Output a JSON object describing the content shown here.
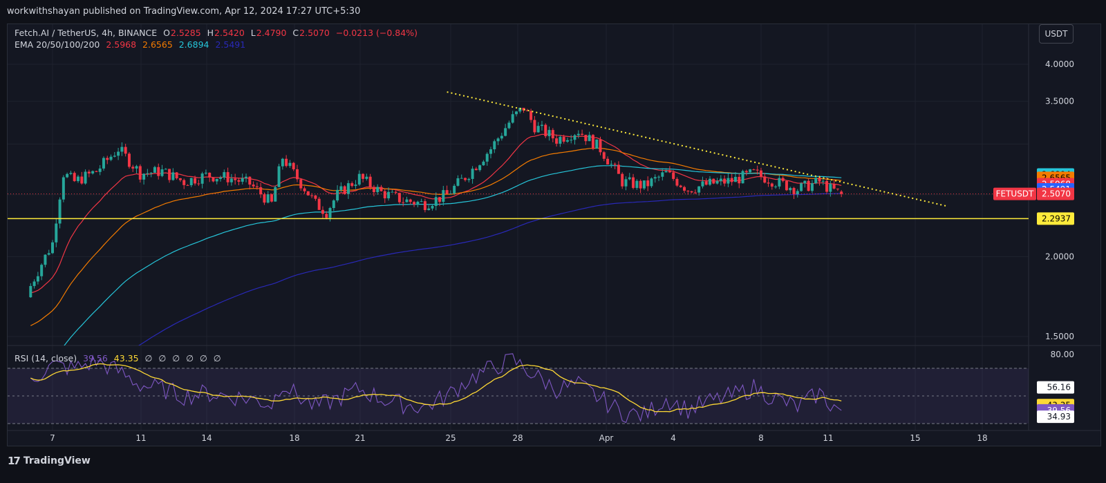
{
  "header": {
    "publisher": "workwithshayan published on TradingView.com, Apr 12, 2024 17:27 UTC+5:30"
  },
  "legend": {
    "symbol": "Fetch.AI / TetherUS, 4h, BINANCE",
    "o_label": "O",
    "o_value": "2.5285",
    "h_label": "H",
    "h_value": "2.5420",
    "l_label": "L",
    "l_value": "2.4790",
    "c_label": "C",
    "c_value": "2.5070",
    "change": "−0.0213 (−0.84%)",
    "ema_label": "EMA 20/50/100/200",
    "ema20": "2.5968",
    "ema50": "2.6565",
    "ema100": "2.6894",
    "ema200": "2.5491"
  },
  "rsi_legend": {
    "label": "RSI (14, close)",
    "rsi": "39.56",
    "ma": "43.35",
    "empties": [
      "∅",
      "∅",
      "∅",
      "∅",
      "∅",
      "∅"
    ]
  },
  "currency_button": "USDT",
  "footer": {
    "brand": "TradingView",
    "brand_mark": "17"
  },
  "colors": {
    "up": "#26a69a",
    "down": "#f23645",
    "ema20": "#f23645",
    "ema50": "#f57c00",
    "ema100": "#26c6da",
    "ema200": "#2929b8",
    "support": "#ffeb3b",
    "trendline": "#ffeb3b",
    "rsi": "#7e57c2",
    "rsi_ma": "#fdd835"
  },
  "chart_data": [
    {
      "type": "candlestick",
      "title": "Fetch.AI / TetherUS, 4h, BINANCE",
      "x_ticks": [
        "7",
        "11",
        "14",
        "18",
        "21",
        "25",
        "28",
        "Apr",
        "4",
        "8",
        "11",
        "15",
        "18"
      ],
      "y_ticks": [
        "4.0000",
        "3.5000",
        "2.0000",
        "1.5000"
      ],
      "ylim": [
        1.45,
        4.3
      ],
      "price_scale": "log",
      "anchors": [
        {
          "t": "Mar 6",
          "p": 1.8
        },
        {
          "t": "Mar 7",
          "p": 2.1
        },
        {
          "t": "Mar 7.5",
          "p": 2.7
        },
        {
          "t": "Mar 8",
          "p": 2.62
        },
        {
          "t": "Mar 9",
          "p": 2.72
        },
        {
          "t": "Mar 10",
          "p": 2.95
        },
        {
          "t": "Mar 11",
          "p": 2.7
        },
        {
          "t": "Mar 12",
          "p": 2.72
        },
        {
          "t": "Mar 13",
          "p": 2.62
        },
        {
          "t": "Mar 14",
          "p": 2.68
        },
        {
          "t": "Mar 15",
          "p": 2.66
        },
        {
          "t": "Mar 16",
          "p": 2.6
        },
        {
          "t": "Mar 17",
          "p": 2.42
        },
        {
          "t": "Mar 17.5",
          "p": 2.86
        },
        {
          "t": "Mar 18",
          "p": 2.7
        },
        {
          "t": "Mar 19",
          "p": 2.42
        },
        {
          "t": "Mar 19.5",
          "p": 2.35
        },
        {
          "t": "Mar 20",
          "p": 2.5
        },
        {
          "t": "Mar 21",
          "p": 2.66
        },
        {
          "t": "Mar 22",
          "p": 2.52
        },
        {
          "t": "Mar 23",
          "p": 2.45
        },
        {
          "t": "Mar 24",
          "p": 2.42
        },
        {
          "t": "Mar 25",
          "p": 2.5
        },
        {
          "t": "Mar 26",
          "p": 2.7
        },
        {
          "t": "Mar 27",
          "p": 2.95
        },
        {
          "t": "Mar 28",
          "p": 3.3
        },
        {
          "t": "Mar 28.5",
          "p": 3.42
        },
        {
          "t": "Mar 29",
          "p": 3.2
        },
        {
          "t": "Mar 30",
          "p": 3.05
        },
        {
          "t": "Mar 31",
          "p": 3.15
        },
        {
          "t": "Apr 1",
          "p": 2.95
        },
        {
          "t": "Apr 2",
          "p": 2.62
        },
        {
          "t": "Apr 3",
          "p": 2.58
        },
        {
          "t": "Apr 4",
          "p": 2.7
        },
        {
          "t": "Apr 5",
          "p": 2.55
        },
        {
          "t": "Apr 6",
          "p": 2.6
        },
        {
          "t": "Apr 7",
          "p": 2.63
        },
        {
          "t": "Apr 8",
          "p": 2.7
        },
        {
          "t": "Apr 9",
          "p": 2.62
        },
        {
          "t": "Apr 10",
          "p": 2.55
        },
        {
          "t": "Apr 11",
          "p": 2.62
        },
        {
          "t": "Apr 11.5",
          "p": 2.55
        },
        {
          "t": "Apr 12",
          "p": 2.507
        }
      ],
      "trendline": {
        "start": {
          "t": "Mar 25",
          "p": 3.62
        },
        "end": {
          "t": "Apr 16.8",
          "p": 2.4
        },
        "style": "dotted"
      },
      "support_level": 2.2937,
      "last_price": 2.507,
      "price_labels": [
        {
          "text": "2.6894",
          "value": 2.6894,
          "color": "#26c6da"
        },
        {
          "text": "2.6565",
          "value": 2.6565,
          "color": "#f57c00"
        },
        {
          "text": "2.5968",
          "value": 2.5968,
          "color": "#f23645"
        },
        {
          "text": "2.5491",
          "value": 2.5491,
          "color": "#2962ff"
        },
        {
          "text": "2.5070",
          "value": 2.507,
          "color": "#f23645",
          "tag": "FETUSDT"
        },
        {
          "text": "2.2937",
          "value": 2.2937,
          "color": "#ffeb3b"
        }
      ],
      "series": [
        {
          "name": "EMA 20",
          "last": 2.5968
        },
        {
          "name": "EMA 50",
          "last": 2.6565
        },
        {
          "name": "EMA 100",
          "last": 2.6894
        },
        {
          "name": "EMA 200",
          "last": 2.5491
        }
      ]
    },
    {
      "type": "line",
      "title": "RSI (14, close)",
      "y_ticks": [
        "80.00"
      ],
      "ylim": [
        25,
        85
      ],
      "bands": [
        70,
        50,
        30
      ],
      "anchors": [
        {
          "t": "Mar 6",
          "v": 62
        },
        {
          "t": "Mar 7",
          "v": 72
        },
        {
          "t": "Mar 8",
          "v": 70
        },
        {
          "t": "Mar 9",
          "v": 75
        },
        {
          "t": "Mar 10",
          "v": 68
        },
        {
          "t": "Mar 11",
          "v": 58
        },
        {
          "t": "Mar 12",
          "v": 55
        },
        {
          "t": "Mar 13",
          "v": 50
        },
        {
          "t": "Mar 14",
          "v": 52
        },
        {
          "t": "Mar 15",
          "v": 50
        },
        {
          "t": "Mar 16",
          "v": 48
        },
        {
          "t": "Mar 17",
          "v": 44
        },
        {
          "t": "Mar 17.5",
          "v": 60
        },
        {
          "t": "Mar 18",
          "v": 52
        },
        {
          "t": "Mar 19",
          "v": 42
        },
        {
          "t": "Mar 20",
          "v": 48
        },
        {
          "t": "Mar 21",
          "v": 55
        },
        {
          "t": "Mar 22",
          "v": 48
        },
        {
          "t": "Mar 23",
          "v": 44
        },
        {
          "t": "Mar 24",
          "v": 42
        },
        {
          "t": "Mar 25",
          "v": 50
        },
        {
          "t": "Mar 26",
          "v": 62
        },
        {
          "t": "Mar 27",
          "v": 70
        },
        {
          "t": "Mar 28",
          "v": 76
        },
        {
          "t": "Mar 29",
          "v": 65
        },
        {
          "t": "Mar 30",
          "v": 55
        },
        {
          "t": "Mar 31",
          "v": 58
        },
        {
          "t": "Apr 1",
          "v": 48
        },
        {
          "t": "Apr 2",
          "v": 38
        },
        {
          "t": "Apr 3",
          "v": 36
        },
        {
          "t": "Apr 4",
          "v": 48
        },
        {
          "t": "Apr 5",
          "v": 40
        },
        {
          "t": "Apr 6",
          "v": 46
        },
        {
          "t": "Apr 7",
          "v": 50
        },
        {
          "t": "Apr 8",
          "v": 56
        },
        {
          "t": "Apr 9",
          "v": 48
        },
        {
          "t": "Apr 10",
          "v": 42
        },
        {
          "t": "Apr 11",
          "v": 52
        },
        {
          "t": "Apr 11.5",
          "v": 44
        },
        {
          "t": "Apr 12",
          "v": 39.56
        }
      ],
      "ma_last": 43.35,
      "rsi_last": 39.56,
      "value_labels": [
        {
          "text": "56.16",
          "value": 56.16,
          "style": "white"
        },
        {
          "text": "43.35",
          "value": 43.35,
          "style": "yellow"
        },
        {
          "text": "39.56",
          "value": 39.56,
          "style": "purple"
        },
        {
          "text": "34.93",
          "value": 34.93,
          "style": "white"
        }
      ]
    }
  ]
}
